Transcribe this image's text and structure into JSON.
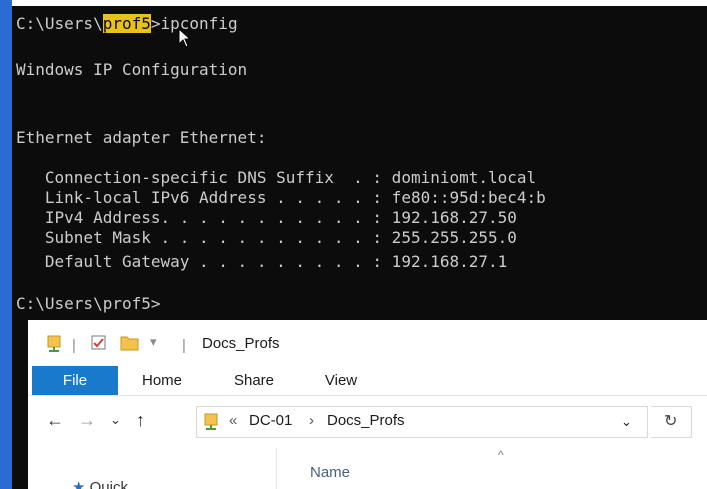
{
  "console": {
    "lines": [
      {
        "prefix": "C:\\Users\\",
        "highlight": "prof5",
        "suffix": ">ipconfig"
      },
      {
        "text": "Windows IP Configuration"
      },
      {
        "text": "Ethernet adapter Ethernet:"
      },
      {
        "text": "   Connection-specific DNS Suffix  . : dominiomt.local"
      },
      {
        "text": "   Link-local IPv6 Address . . . . . : fe80::95d:bec4:b"
      },
      {
        "text": "   IPv4 Address. . . . . . . . . . . : 192.168.27.50"
      },
      {
        "text": "   Subnet Mask . . . . . . . . . . . : 255.255.255.0"
      },
      {
        "text": "   Default Gateway . . . . . . . . . : 192.168.27.1"
      },
      {
        "text": "C:\\Users\\prof5>"
      }
    ]
  },
  "explorer": {
    "title": "Docs_Profs",
    "ribbon_tabs": [
      "File",
      "Home",
      "Share",
      "View"
    ],
    "address": {
      "overflow": "«",
      "crumbs": [
        "DC-01",
        "Docs_Profs"
      ],
      "separator": "›"
    },
    "column_header": "Name",
    "nav_pane_first": "Quick"
  },
  "colors": {
    "console_bg": "#0c0c0c",
    "console_fg": "#cccccc",
    "highlight": "#e8c21a",
    "accent_bar": "#2a6cd3",
    "file_tab": "#1979ca"
  }
}
